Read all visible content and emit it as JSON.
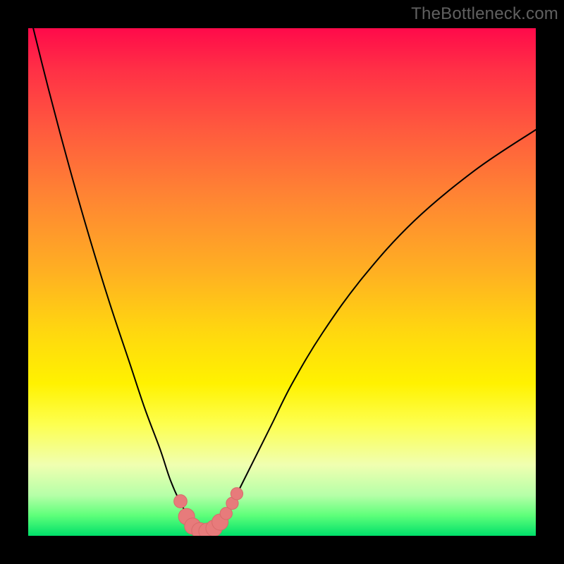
{
  "watermark": "TheBottleneck.com",
  "colors": {
    "frame": "#000000",
    "curve": "#000000",
    "marker_fill": "#e77b7b",
    "marker_stroke": "#d86a6a"
  },
  "chart_data": {
    "type": "line",
    "title": "",
    "xlabel": "",
    "ylabel": "",
    "xlim": [
      0,
      100
    ],
    "ylim": [
      0,
      100
    ],
    "grid": false,
    "legend": false,
    "series": [
      {
        "name": "bottleneck-curve",
        "x": [
          0,
          4,
          8,
          12,
          16,
          20,
          23,
          26,
          28,
          30,
          32,
          33.5,
          35,
          36.5,
          38,
          40,
          42,
          45,
          48,
          52,
          58,
          66,
          76,
          88,
          100
        ],
        "y": [
          104,
          88,
          73,
          59,
          46,
          34,
          25,
          17,
          11,
          6.5,
          3.2,
          1.6,
          0.9,
          1.5,
          3.0,
          6.0,
          10,
          16,
          22,
          30,
          40,
          51,
          62,
          72,
          80
        ]
      }
    ],
    "markers": [
      {
        "x": 30.0,
        "y": 6.8,
        "r": 1.3
      },
      {
        "x": 31.2,
        "y": 3.8,
        "r": 1.6
      },
      {
        "x": 32.4,
        "y": 1.9,
        "r": 1.6
      },
      {
        "x": 33.8,
        "y": 1.0,
        "r": 1.6
      },
      {
        "x": 35.2,
        "y": 0.9,
        "r": 1.6
      },
      {
        "x": 36.6,
        "y": 1.5,
        "r": 1.6
      },
      {
        "x": 37.8,
        "y": 2.7,
        "r": 1.6
      },
      {
        "x": 39.0,
        "y": 4.4,
        "r": 1.2
      },
      {
        "x": 40.2,
        "y": 6.4,
        "r": 1.2
      },
      {
        "x": 41.1,
        "y": 8.3,
        "r": 1.2
      }
    ],
    "annotations": []
  }
}
